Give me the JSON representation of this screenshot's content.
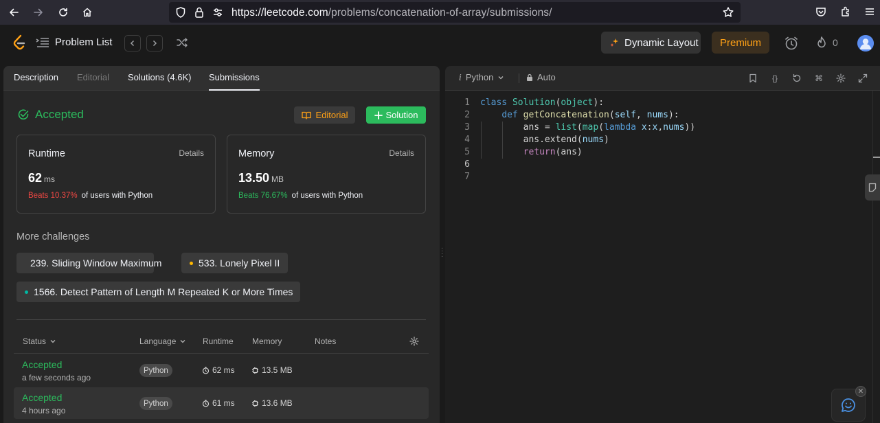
{
  "browser": {
    "url_domain": "https://leetcode.com",
    "url_path": "/problems/concatenation-of-array/submissions/"
  },
  "header": {
    "problem_list": "Problem List",
    "dynamic_layout": "Dynamic Layout",
    "premium": "Premium",
    "streak_count": "0"
  },
  "tabs": {
    "description": "Description",
    "editorial": "Editorial",
    "solutions": "Solutions (4.6K)",
    "submissions": "Submissions"
  },
  "result": {
    "status": "Accepted",
    "editorial_btn": "Editorial",
    "solution_btn": "Solution",
    "runtime": {
      "label": "Runtime",
      "details": "Details",
      "value": "62",
      "unit": "ms",
      "beats": "Beats 10.37%",
      "rest": "of users with Python"
    },
    "memory": {
      "label": "Memory",
      "details": "Details",
      "value": "13.50",
      "unit": "MB",
      "beats": "Beats 76.67%",
      "rest": "of users with Python"
    }
  },
  "challenges": {
    "title": "More challenges",
    "items": [
      {
        "label": "239. Sliding Window Maximum",
        "color": "#ef4743"
      },
      {
        "label": "533. Lonely Pixel II",
        "color": "#ffb800"
      },
      {
        "label": "1566. Detect Pattern of Length M Repeated K or More Times",
        "color": "#00b8a3"
      }
    ]
  },
  "table": {
    "headers": {
      "status": "Status",
      "language": "Language",
      "runtime": "Runtime",
      "memory": "Memory",
      "notes": "Notes"
    },
    "rows": [
      {
        "status": "Accepted",
        "time": "a few seconds ago",
        "language": "Python",
        "runtime": "62 ms",
        "memory": "13.5 MB"
      },
      {
        "status": "Accepted",
        "time": "4 hours ago",
        "language": "Python",
        "runtime": "61 ms",
        "memory": "13.6 MB"
      }
    ]
  },
  "editor": {
    "language": "Python",
    "auto": "Auto",
    "line_numbers": [
      "1",
      "2",
      "3",
      "4",
      "5",
      "6",
      "7"
    ],
    "code_lines": [
      "class Solution(object):",
      "    def getConcatenation(self, nums):",
      "        ans = list(map(lambda x:x,nums))",
      "        ans.extend(nums)",
      "        return(ans)",
      "",
      ""
    ]
  },
  "colors": {
    "accent_green": "#2cbb5d",
    "accent_orange": "#ffa116",
    "accent_red": "#ef4743"
  }
}
